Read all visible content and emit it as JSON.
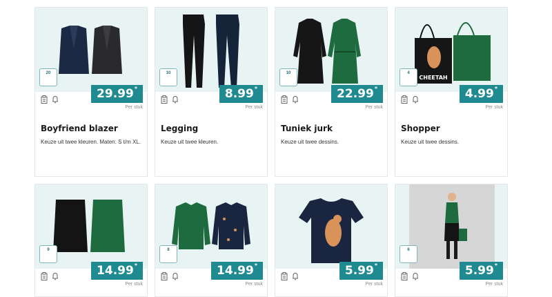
{
  "products": [
    {
      "title": "Boyfriend blazer",
      "desc": "Keuze uit twee kleuren. Maten: S t/m XL.",
      "price": "29.99",
      "unit": "Per stuk",
      "badge": "20"
    },
    {
      "title": "Legging",
      "desc": "Keuze uit twee kleuren.",
      "price": "8.99",
      "unit": "Per stuk",
      "badge": "10"
    },
    {
      "title": "Tuniek jurk",
      "desc": "Keuze uit twee dessins.",
      "price": "22.99",
      "unit": "Per stuk",
      "badge": "10"
    },
    {
      "title": "Shopper",
      "desc": "Keuze uit twee dessins.",
      "price": "4.99",
      "unit": "Per stuk",
      "badge": "4",
      "bag_text": "CHEETAH"
    },
    {
      "price": "14.99",
      "unit": "Per stuk",
      "badge": "9"
    },
    {
      "price": "14.99",
      "unit": "Per stuk",
      "badge": "8"
    },
    {
      "price": "5.99",
      "unit": "Per stuk"
    },
    {
      "price": "5.99",
      "unit": "Per stuk",
      "badge": "6"
    }
  ],
  "colors": {
    "accent": "#1f8a8f",
    "image_bg": "#e8f3f4",
    "green_print": "#1e6b3f",
    "navy": "#1a2640"
  },
  "icons": {
    "list": "clipboard-icon",
    "notify": "bell-icon"
  },
  "price_mark": "*"
}
